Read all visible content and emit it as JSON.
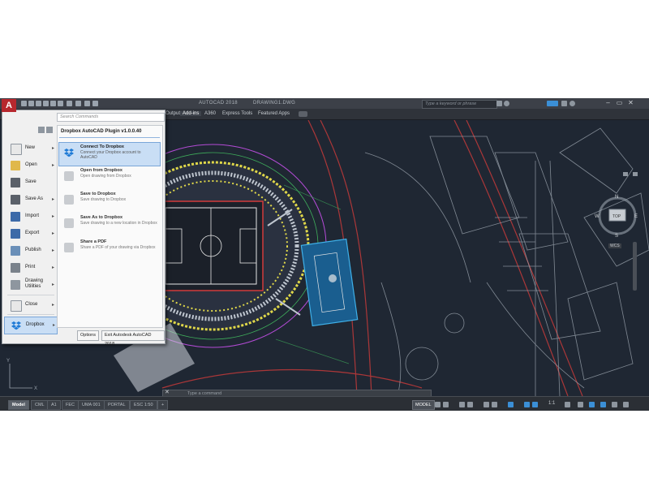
{
  "titlebar": {
    "app_title": "AUTOCAD 2018",
    "doc_title": "DRAWING1.DWG",
    "search_placeholder": "Type a keyword or phrase",
    "logo_letter": "A"
  },
  "ribbon": {
    "tabs": [
      "Output",
      "Add-ins",
      "A360",
      "Express Tools",
      "Featured Apps"
    ],
    "active_tab": "Add-ins"
  },
  "app_menu": {
    "search_placeholder": "Search Commands",
    "left_items": [
      {
        "label": "New",
        "icon": "new-icon"
      },
      {
        "label": "Open",
        "icon": "open-icon"
      },
      {
        "label": "Save",
        "icon": "save-icon"
      },
      {
        "label": "Save As",
        "icon": "save-as-icon"
      },
      {
        "label": "Import",
        "icon": "import-icon"
      },
      {
        "label": "Export",
        "icon": "export-icon"
      },
      {
        "label": "Publish",
        "icon": "publish-icon"
      },
      {
        "label": "Print",
        "icon": "print-icon"
      },
      {
        "label": "Drawing Utilities",
        "icon": "drawing-utilities-icon"
      },
      {
        "label": "Close",
        "icon": "close-icon"
      },
      {
        "label": "Dropbox",
        "icon": "dropbox-icon"
      }
    ],
    "selected_left": "Dropbox",
    "panel": {
      "title": "Dropbox AutoCAD Plugin v1.0.0.40",
      "items": [
        {
          "title": "Connect To Dropbox",
          "desc": "Connect your Dropbox account to AutoCAD",
          "selected": true
        },
        {
          "title": "Open from Dropbox",
          "desc": "Open drawing from Dropbox",
          "selected": false
        },
        {
          "title": "Save to Dropbox",
          "desc": "Save drawing to Dropbox",
          "selected": false
        },
        {
          "title": "Save As to Dropbox",
          "desc": "Save drawing to a new location in Dropbox",
          "selected": false
        },
        {
          "title": "Share a PDF",
          "desc": "Share a PDF of your drawing via Dropbox",
          "selected": false
        }
      ]
    },
    "options_label": "Options",
    "exit_label": "Exit Autodesk AutoCAD 2018"
  },
  "viewcube": {
    "north": "N",
    "south": "S",
    "east": "E",
    "west": "W",
    "face": "TOP",
    "wcs": "WCS"
  },
  "command_line": {
    "placeholder": "Type a command"
  },
  "status": {
    "layout_tabs": [
      "Model",
      "CML",
      "A1",
      "FEC",
      "UMA 001",
      "PORTAL",
      "ESC 1:50"
    ],
    "active_layout": "Model",
    "add_tab": "+",
    "model_label": "MODEL",
    "scale": "1:1"
  },
  "colors": {
    "accent": "#3b8fd6",
    "dropbox": "#1e7ad6",
    "app_red": "#b7282e",
    "canvas": "#1f2733"
  }
}
